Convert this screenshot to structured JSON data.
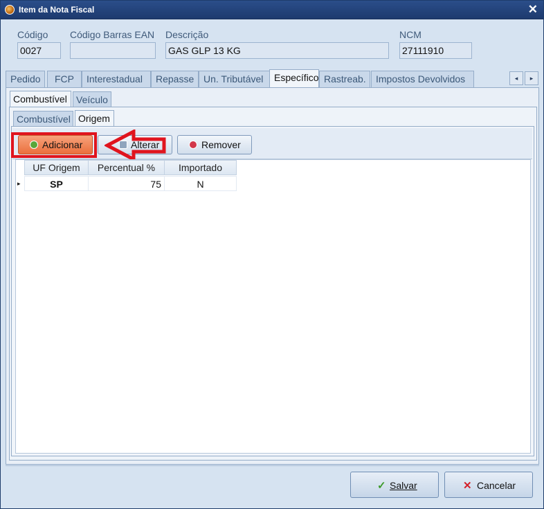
{
  "window": {
    "title": "Item da Nota Fiscal",
    "close_glyph": "✕"
  },
  "header_fields": {
    "codigo": {
      "label": "Código",
      "value": "0027"
    },
    "ean": {
      "label": "Código Barras EAN",
      "value": ""
    },
    "descricao": {
      "label": "Descrição",
      "value": "GAS GLP 13 KG"
    },
    "ncm": {
      "label": "NCM",
      "value": "27111910"
    }
  },
  "main_tabs": [
    {
      "label": "Pedido"
    },
    {
      "label": "FCP"
    },
    {
      "label": "Interestadual"
    },
    {
      "label": "Repasse"
    },
    {
      "label": "Un. Tributável"
    },
    {
      "label": "Específico",
      "active": true
    },
    {
      "label": "Rastreab."
    },
    {
      "label": "Impostos Devolvidos"
    }
  ],
  "tab_scroll": {
    "left_glyph": "◂",
    "right_glyph": "▸"
  },
  "sub_tabs": [
    {
      "label": "Combustível",
      "active": true
    },
    {
      "label": "Veículo"
    }
  ],
  "inner_tabs": [
    {
      "label": "Combustível"
    },
    {
      "label": "Origem",
      "active": true
    }
  ],
  "toolbar": {
    "adicionar_label": "Adicionar",
    "alterar_label": "Alterar",
    "remover_label": "Remover",
    "adicionar_icon": "plus-circle-icon",
    "alterar_icon": "edit-icon",
    "remover_icon": "minus-circle-icon"
  },
  "grid": {
    "columns": [
      "UF Origem",
      "Percentual %",
      "Importado"
    ],
    "rows": [
      {
        "indicator": "▸",
        "uf_origem": "SP",
        "percentual": "75",
        "importado": "N"
      }
    ]
  },
  "buttons": {
    "salvar_label": "Salvar",
    "cancelar_label": "Cancelar",
    "salvar_icon": "check-icon",
    "cancelar_icon": "x-icon"
  },
  "colors": {
    "highlight": "#e0141e",
    "adicionar_button": "#f07f4f",
    "titlebar": "#2b4e8a"
  }
}
